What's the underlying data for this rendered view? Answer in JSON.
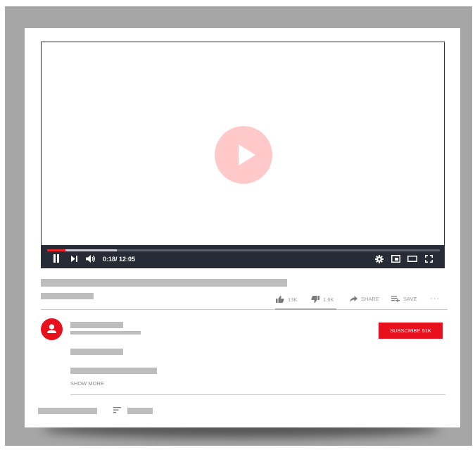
{
  "player": {
    "time_display": "0:18/ 12:05",
    "progress_played_fraction": 0.047,
    "progress_buffered_fraction": 0.178,
    "accent_color": "#e8232a",
    "play_button_color": "#ffc9c9",
    "control_bar_color": "#262b36"
  },
  "actions": {
    "like_count": "13K",
    "dislike_count": "1.6K",
    "share_label": "SHARE",
    "save_label": "SAVE",
    "more_label": "···"
  },
  "channel": {
    "subscribe_label": "SUBSCRIBE 51K",
    "subscribe_color": "#e8101c"
  },
  "description": {
    "show_more_label": "SHOW MORE"
  },
  "icons": {
    "play": "play-icon",
    "pause": "pause-icon",
    "next": "skip-next-icon",
    "volume": "volume-icon",
    "settings": "gear-icon",
    "miniplayer": "miniplayer-icon",
    "theater": "theater-mode-icon",
    "fullscreen": "fullscreen-icon",
    "like": "thumbs-up-icon",
    "dislike": "thumbs-down-icon",
    "share": "share-arrow-icon",
    "save": "playlist-add-icon",
    "avatar": "user-icon",
    "sort": "sort-icon"
  }
}
